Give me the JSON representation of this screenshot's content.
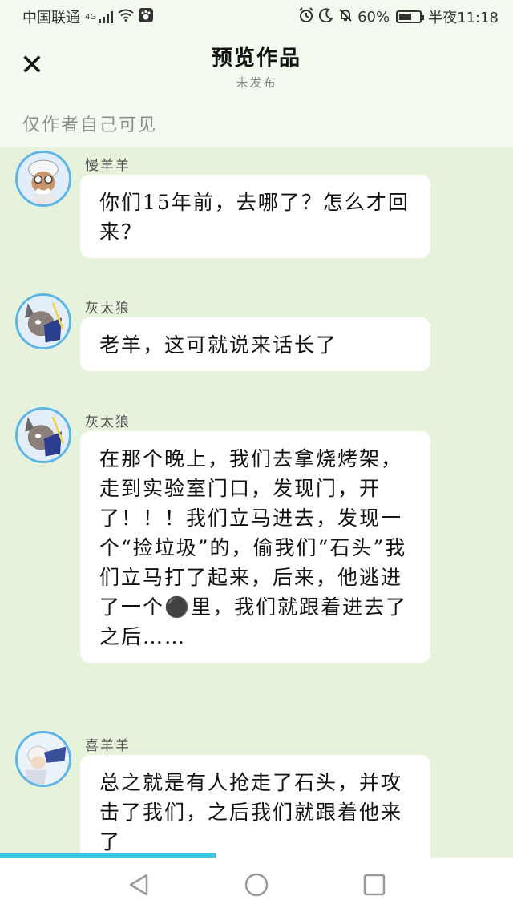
{
  "status_bar": {
    "carrier": "中国联通",
    "network": "4G",
    "battery": "60%",
    "battery_level": 0.6,
    "time": "半夜11:18"
  },
  "header": {
    "title": "预览作品",
    "subtitle": "未发布",
    "visibility_note": "仅作者自己可见"
  },
  "messages": [
    {
      "sender": "慢羊羊",
      "text": "你们15年前，去哪了？怎么才回来？",
      "avatar_icon": "slow-goat-avatar"
    },
    {
      "sender": "灰太狼",
      "text": "老羊，这可就说来话长了",
      "avatar_icon": "grey-wolf-avatar"
    },
    {
      "sender": "灰太狼",
      "text": "在那个晚上，我们去拿烧烤架，走到实验室门口，发现门，开了！！！我们立马进去，发现一个“捡垃圾”的，偷我们“石头”我们立马打了起来，后来，他逃进了一个⚫里，我们就跟着进去了\n之后……",
      "avatar_icon": "grey-wolf-avatar"
    },
    {
      "sender": "喜羊羊",
      "text": "总之就是有人抢走了石头，并攻击了我们，之后我们就跟着他来了",
      "avatar_icon": "pleasant-goat-avatar"
    }
  ],
  "progress": {
    "value": 0.42
  },
  "colors": {
    "background": "#e6f2dc",
    "header_bg": "#f3fbee",
    "avatar_border": "#5fb4e6",
    "progress": "#36c8e3"
  },
  "nav_bar": {
    "icons": [
      "back-triangle-icon",
      "home-circle-icon",
      "recents-square-icon"
    ]
  }
}
